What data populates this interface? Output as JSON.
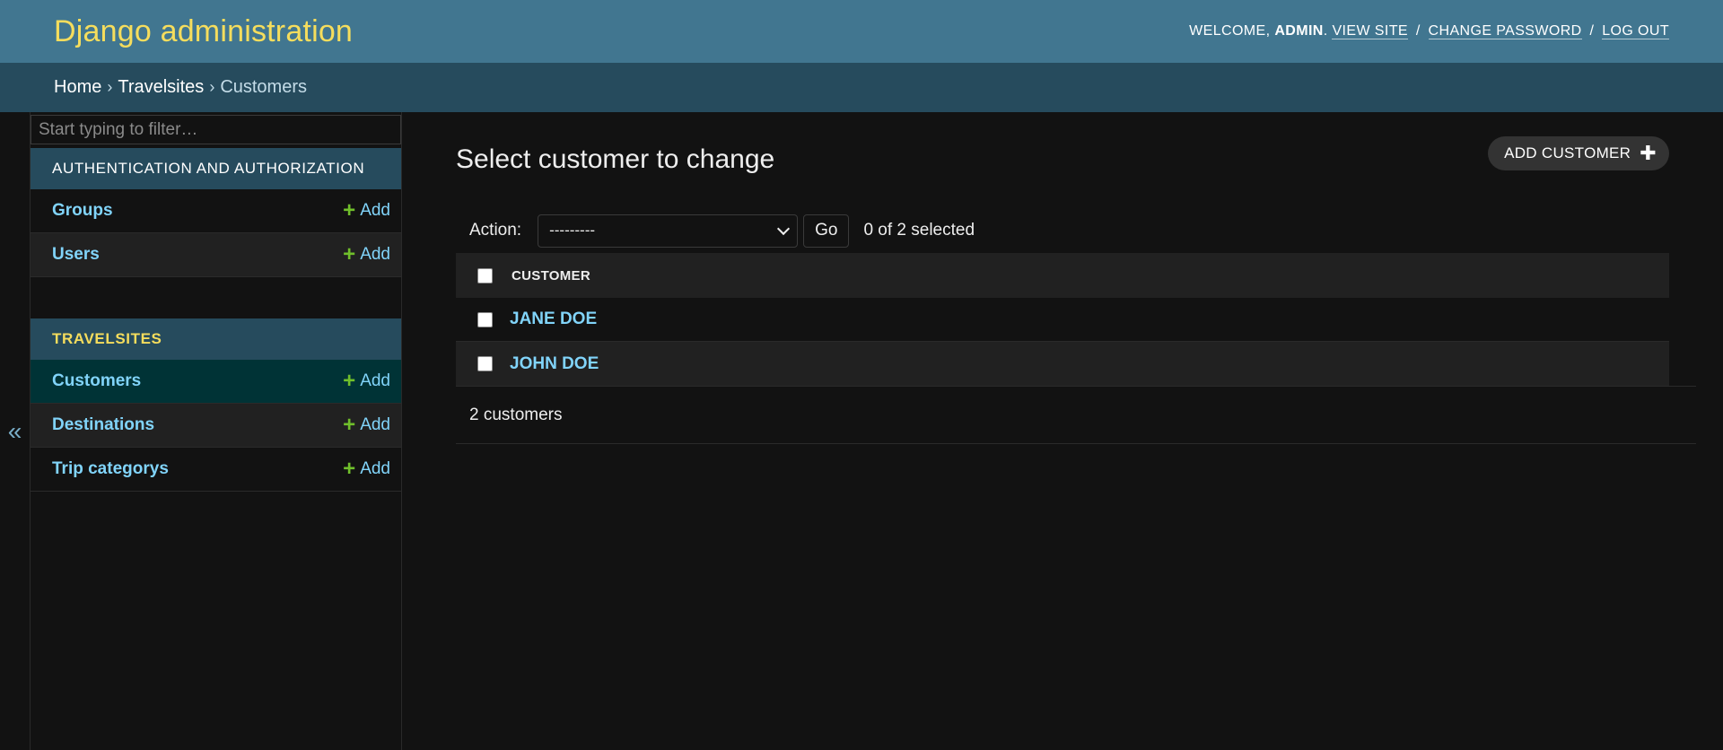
{
  "header": {
    "site_title": "Django administration",
    "welcome": "Welcome,",
    "username": "admin",
    "view_site": "View site",
    "change_password": "Change password",
    "log_out": "Log out"
  },
  "breadcrumbs": {
    "home": "Home",
    "app": "Travelsites",
    "current": "Customers",
    "separator": "›"
  },
  "sidebar": {
    "filter_placeholder": "Start typing to filter…",
    "toggle_glyph": "«",
    "modules": [
      {
        "caption": "Authentication and Authorization",
        "models": [
          {
            "name": "Groups",
            "add": "Add"
          },
          {
            "name": "Users",
            "add": "Add"
          }
        ]
      },
      {
        "caption": "Travelsites",
        "models": [
          {
            "name": "Customers",
            "add": "Add"
          },
          {
            "name": "Destinations",
            "add": "Add"
          },
          {
            "name": "Trip categorys",
            "add": "Add"
          }
        ]
      }
    ]
  },
  "content": {
    "title": "Select customer to change",
    "add_button": "Add customer",
    "action_label": "Action:",
    "action_selected": "---------",
    "go_label": "Go",
    "selection_count": "0 of 2 selected",
    "column_header": "Customer",
    "rows": [
      "Jane Doe",
      "John Doe"
    ],
    "paginator": "2 customers"
  },
  "colors": {
    "header_bg": "#417690",
    "breadcrumbs_bg": "#264b5d",
    "title_yellow": "#f5dd5d",
    "link_blue": "#81d4fa",
    "add_green": "#70bf2b",
    "selected_row": "#003336",
    "page_bg": "#121212"
  }
}
